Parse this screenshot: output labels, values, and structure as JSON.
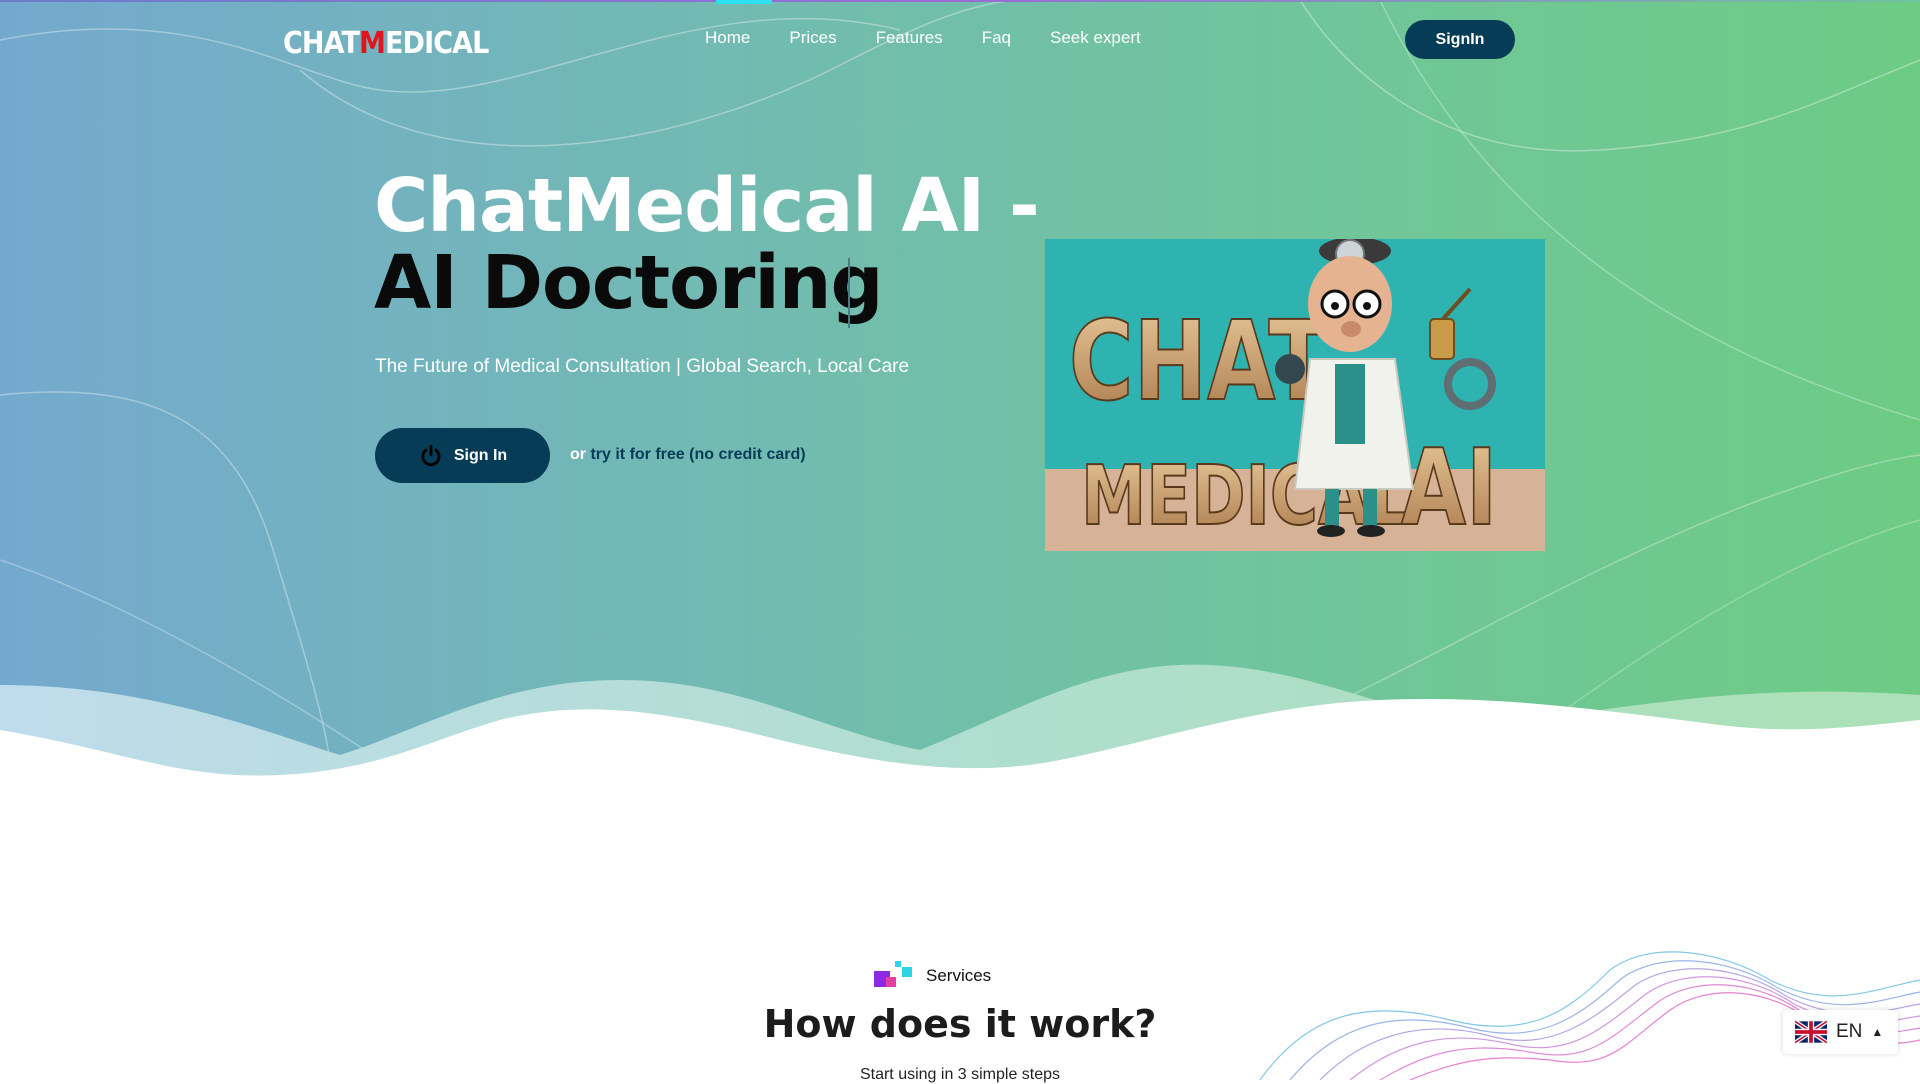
{
  "brand": {
    "logo_prefix": "CHAT",
    "logo_m": "M",
    "logo_suffix": "EDICAL"
  },
  "nav": {
    "items": [
      {
        "label": "Home",
        "active": true
      },
      {
        "label": "Prices"
      },
      {
        "label": "Features"
      },
      {
        "label": "Faq"
      },
      {
        "label": "Seek expert"
      }
    ],
    "signin_label": "SignIn"
  },
  "hero": {
    "title_line1": "ChatMedical AI -",
    "title_line2": "AI Doctoring",
    "subtitle": "The Future of Medical Consultation | Global Search, Local Care",
    "cta_label": "Sign In",
    "or_text": "or",
    "try_link": "try it for free (no credit card)",
    "image": {
      "word1": "CHAT",
      "word2": "MEDICAL",
      "word3": "AI",
      "icon": "cartoon-doctor"
    }
  },
  "services": {
    "tag": "Services",
    "title": "How does it work?",
    "subtitle": "Start using in 3 simple steps"
  },
  "language": {
    "code": "EN",
    "flag": "uk-flag-icon"
  },
  "colors": {
    "accent": "#073c57",
    "brand_red": "#e4141b",
    "nav_active": "#2de0f0"
  }
}
